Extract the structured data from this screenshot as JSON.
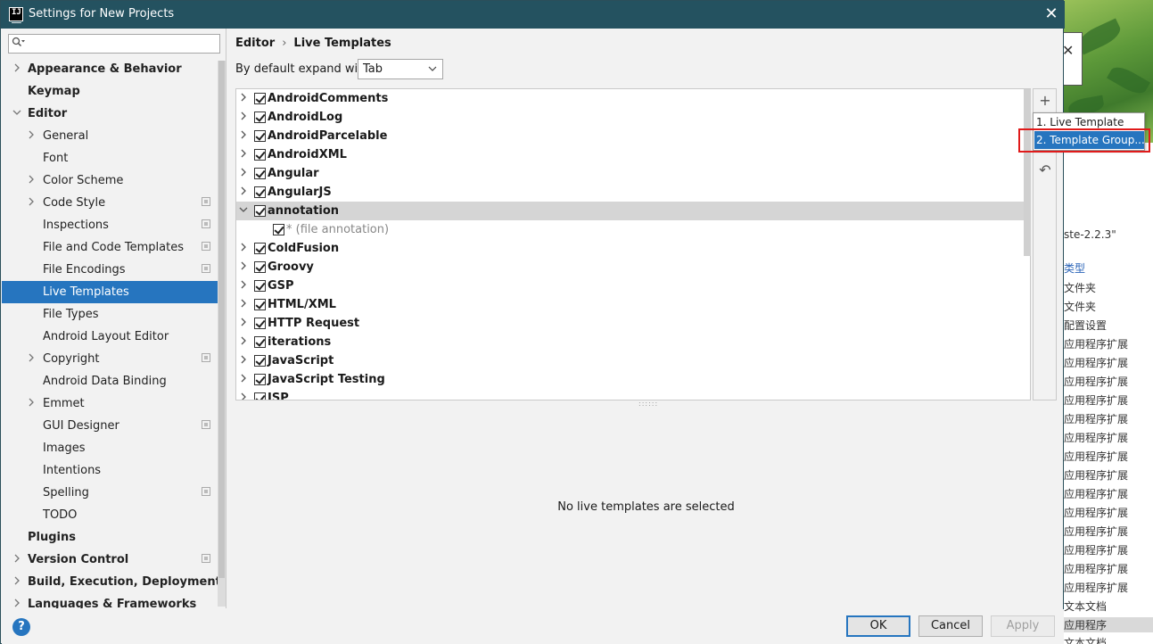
{
  "window": {
    "title": "Settings for New Projects",
    "close_glyph": "✕"
  },
  "search": {
    "placeholder": "",
    "icon": "search-icon"
  },
  "sidebar": {
    "items": [
      {
        "label": "Appearance & Behavior",
        "level": 0,
        "bold": true,
        "chevron": "right"
      },
      {
        "label": "Keymap",
        "level": 0,
        "bold": true
      },
      {
        "label": "Editor",
        "level": 0,
        "bold": true,
        "chevron": "down"
      },
      {
        "label": "General",
        "level": 1,
        "chevron": "right"
      },
      {
        "label": "Font",
        "level": 1
      },
      {
        "label": "Color Scheme",
        "level": 1,
        "chevron": "right"
      },
      {
        "label": "Code Style",
        "level": 1,
        "chevron": "right",
        "project": true
      },
      {
        "label": "Inspections",
        "level": 1,
        "project": true
      },
      {
        "label": "File and Code Templates",
        "level": 1,
        "project": true
      },
      {
        "label": "File Encodings",
        "level": 1,
        "project": true
      },
      {
        "label": "Live Templates",
        "level": 1,
        "selected": true
      },
      {
        "label": "File Types",
        "level": 1
      },
      {
        "label": "Android Layout Editor",
        "level": 1
      },
      {
        "label": "Copyright",
        "level": 1,
        "chevron": "right",
        "project": true
      },
      {
        "label": "Android Data Binding",
        "level": 1
      },
      {
        "label": "Emmet",
        "level": 1,
        "chevron": "right"
      },
      {
        "label": "GUI Designer",
        "level": 1,
        "project": true
      },
      {
        "label": "Images",
        "level": 1
      },
      {
        "label": "Intentions",
        "level": 1
      },
      {
        "label": "Spelling",
        "level": 1,
        "project": true
      },
      {
        "label": "TODO",
        "level": 1
      },
      {
        "label": "Plugins",
        "level": 0,
        "bold": true
      },
      {
        "label": "Version Control",
        "level": 0,
        "bold": true,
        "chevron": "right",
        "project": true
      },
      {
        "label": "Build, Execution, Deployment",
        "level": 0,
        "bold": true,
        "chevron": "right"
      },
      {
        "label": "Languages & Frameworks",
        "level": 0,
        "bold": true,
        "chevron": "right"
      }
    ]
  },
  "breadcrumb": {
    "parent": "Editor",
    "separator": "›",
    "current": "Live Templates"
  },
  "expand": {
    "label": "By default expand with",
    "value": "Tab"
  },
  "templates": [
    {
      "label": "AndroidComments",
      "expanded": false
    },
    {
      "label": "AndroidLog",
      "expanded": false
    },
    {
      "label": "AndroidParcelable",
      "expanded": false
    },
    {
      "label": "AndroidXML",
      "expanded": false
    },
    {
      "label": "Angular",
      "expanded": false
    },
    {
      "label": "AngularJS",
      "expanded": false
    },
    {
      "label": "annotation",
      "expanded": true,
      "selected": true
    },
    {
      "label": "* (file annotation)",
      "child": true
    },
    {
      "label": "ColdFusion",
      "expanded": false
    },
    {
      "label": "Groovy",
      "expanded": false
    },
    {
      "label": "GSP",
      "expanded": false
    },
    {
      "label": "HTML/XML",
      "expanded": false
    },
    {
      "label": "HTTP Request",
      "expanded": false
    },
    {
      "label": "iterations",
      "expanded": false
    },
    {
      "label": "JavaScript",
      "expanded": false
    },
    {
      "label": "JavaScript Testing",
      "expanded": false
    },
    {
      "label": "JSP",
      "expanded": false
    }
  ],
  "toolbar": {
    "add_glyph": "+",
    "restore_glyph": "↶"
  },
  "add_menu": {
    "items": [
      {
        "label": "1. Live Template"
      },
      {
        "label": "2. Template Group...",
        "selected": true
      }
    ]
  },
  "details": {
    "empty_message": "No live templates are selected"
  },
  "footer": {
    "help": "?",
    "ok": "OK",
    "cancel": "Cancel",
    "apply": "Apply"
  },
  "background_window": {
    "items": [
      "ste-2.2.3\"",
      "类型",
      "文件夹",
      "文件夹",
      "配置设置",
      "应用程序扩展",
      "应用程序扩展",
      "应用程序扩展",
      "应用程序扩展",
      "应用程序扩展",
      "应用程序扩展",
      "应用程序扩展",
      "应用程序扩展",
      "应用程序扩展",
      "应用程序扩展",
      "应用程序扩展",
      "应用程序扩展",
      "应用程序扩展",
      "应用程序扩展",
      "文本文档",
      "应用程序",
      "文本文档"
    ],
    "close_glyph": "✕"
  }
}
